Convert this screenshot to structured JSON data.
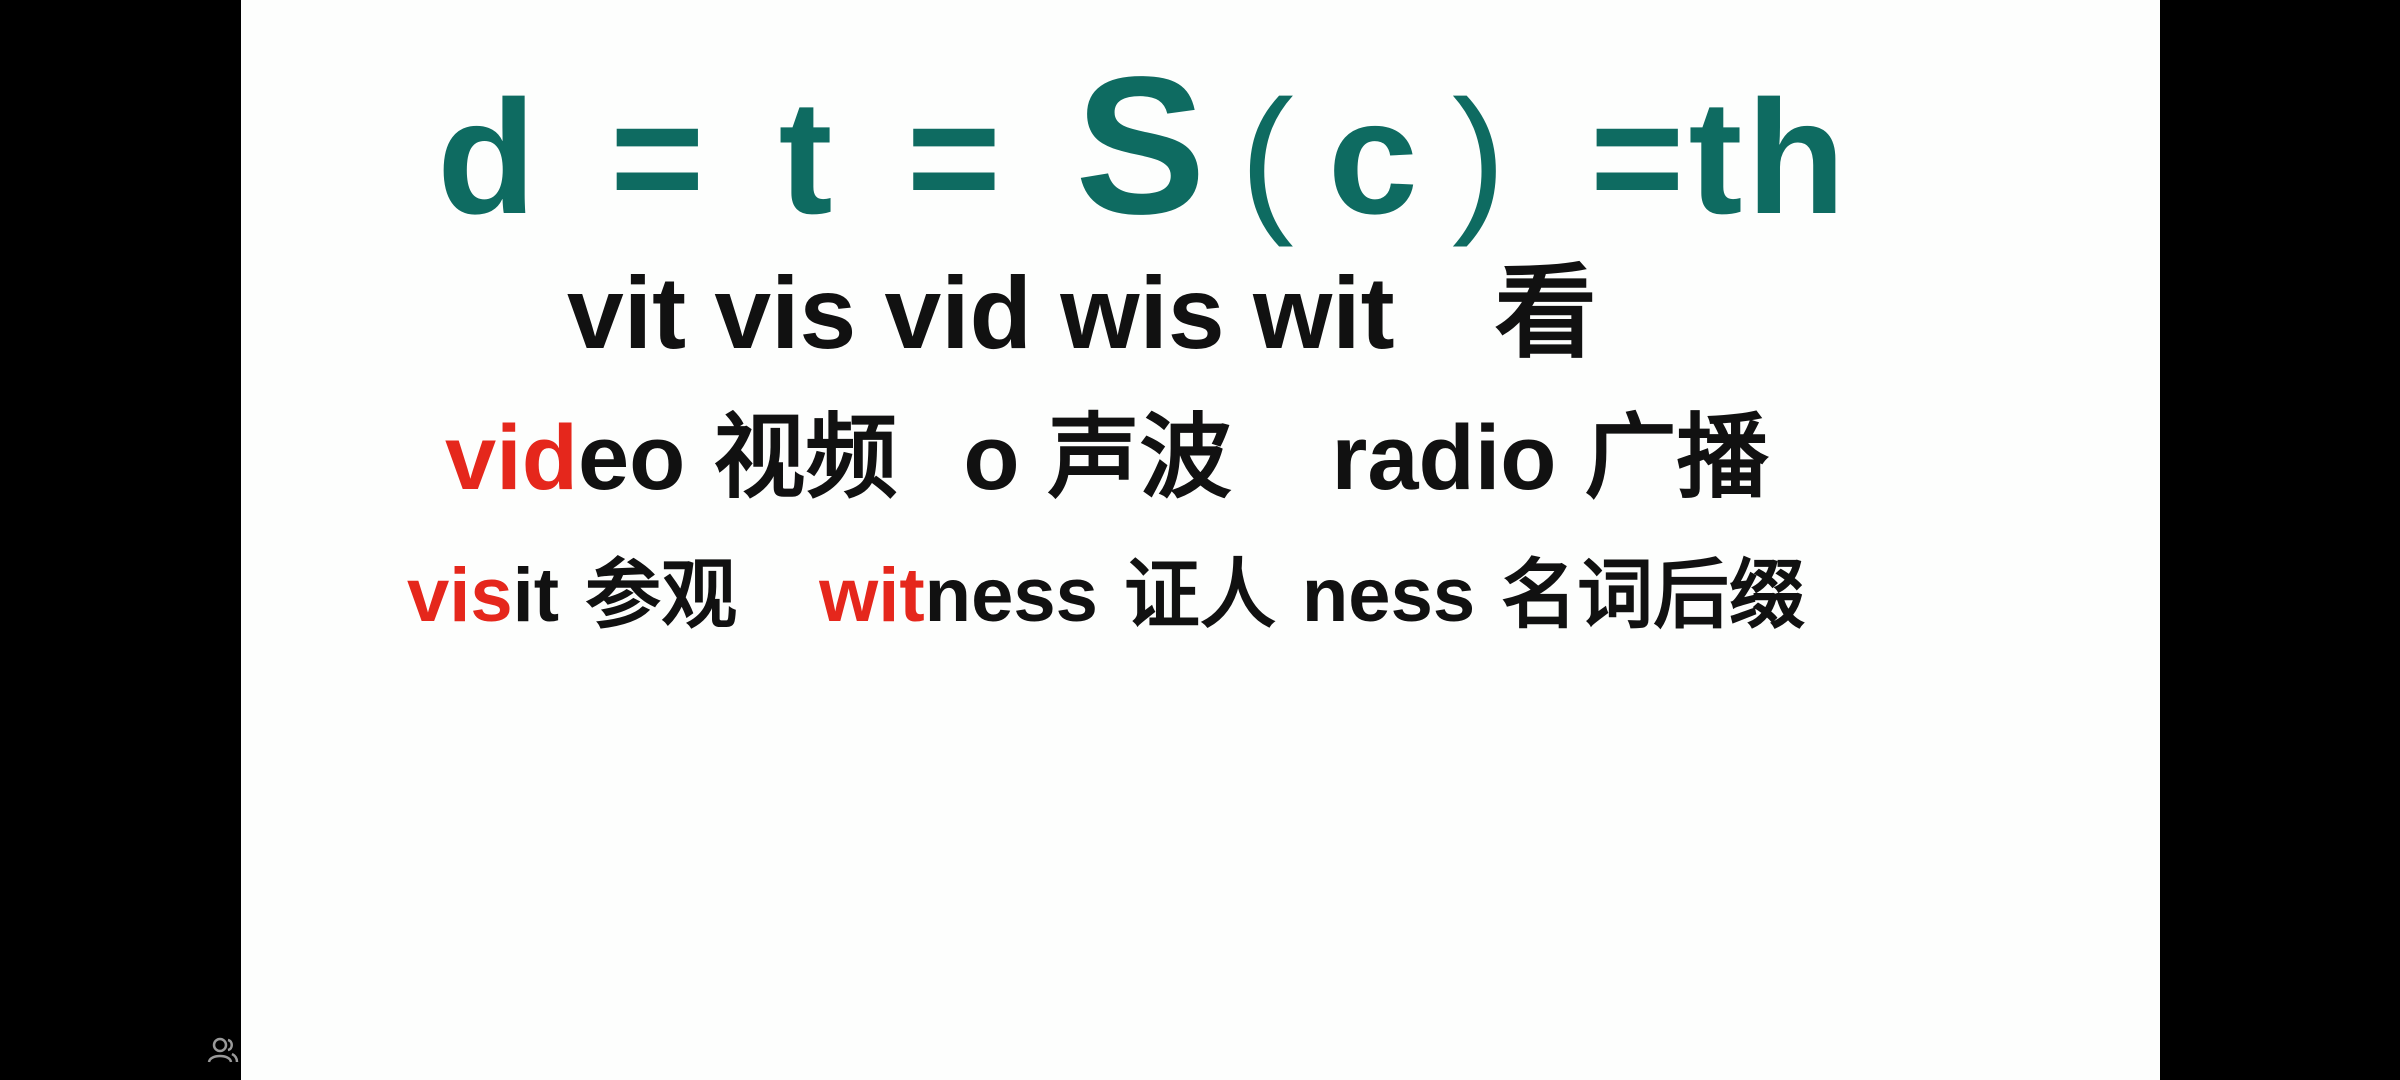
{
  "formula": {
    "d": "d",
    "eq1": "=",
    "t": "t",
    "eq2": "=",
    "s": "S",
    "open_paren": "(",
    "c": "c",
    "close_paren": ")",
    "eq3": "=",
    "th": "th"
  },
  "line1": {
    "roots": "vit vis vid wis wit",
    "meaning": "看"
  },
  "line2": {
    "word1_root": "vid",
    "word1_rest": "eo",
    "word1_meaning": "视频",
    "note_letter": "o",
    "note_meaning": "声波",
    "word2": "radio",
    "word2_meaning": "广播"
  },
  "line3": {
    "word1_root": "vis",
    "word1_rest": "it",
    "word1_meaning": "参观",
    "word2_root": "wit",
    "word2_rest": "ness",
    "word2_meaning": "证人",
    "suffix": "ness",
    "suffix_meaning": "名词后缀"
  },
  "colors": {
    "formula": "#0e6b61",
    "highlight": "#e5271c",
    "text": "#111111",
    "slide_background": "#fdfefd",
    "frame": "#000000"
  },
  "icons": {
    "corner": "people-icon"
  }
}
